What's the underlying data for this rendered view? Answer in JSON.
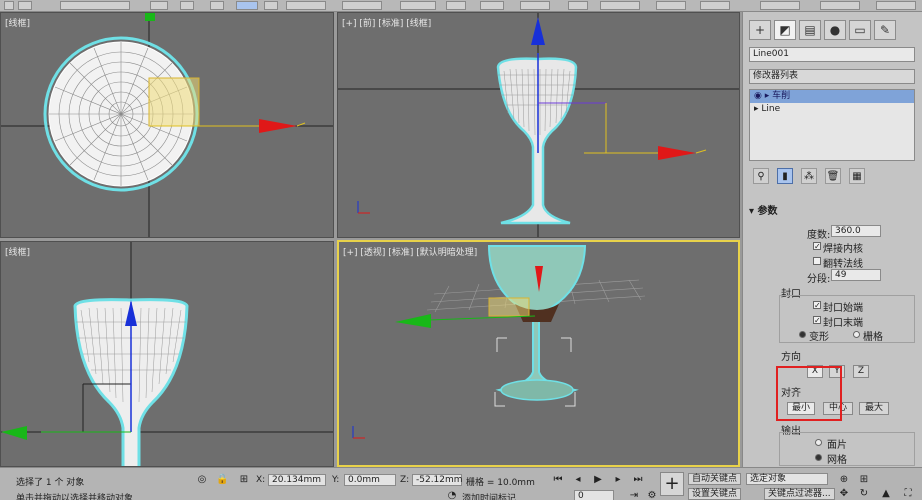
{
  "viewports": {
    "top_left": {
      "label": "[线框]"
    },
    "top_right": {
      "label": "[+] [前] [标准] [线框]"
    },
    "bottom_left": {
      "label": "[线框]"
    },
    "bottom_right": {
      "label": "[+] [透视] [标准] [默认明暗处理]"
    }
  },
  "panel": {
    "object_name": "Line001",
    "modifier_list": "修改器列表",
    "stack": [
      {
        "label": "车削",
        "selected": true
      },
      {
        "label": "Line",
        "selected": false
      }
    ],
    "params_title": "参数",
    "degrees_label": "度数:",
    "degrees_value": "360.0",
    "weld_core": "焊接内核",
    "flip_normals": "翻转法线",
    "segments_label": "分段:",
    "segments_value": "49",
    "capping_title": "封口",
    "cap_start": "封口始端",
    "cap_end": "封口末端",
    "morph": "变形",
    "grid": "栅格",
    "direction_title": "方向",
    "dir_x": "X",
    "dir_y": "Y",
    "dir_z": "Z",
    "align_title": "对齐",
    "align_min": "最小",
    "align_center": "中心",
    "align_max": "最大",
    "output_title": "输出",
    "out_patch": "面片",
    "out_mesh": "网格"
  },
  "status": {
    "selection": "选择了 1 个 对象",
    "hint": "单击并拖动以选择并移动对象",
    "x_label": "X:",
    "x_value": "20.134mm",
    "y_label": "Y:",
    "y_value": "0.0mm",
    "z_label": "Z:",
    "z_value": "-52.12mm",
    "grid_label": "栅格 = 10.0mm",
    "add_time_tag": "添加时间标记",
    "auto_key": "自动关键点",
    "selected_obj": "选定对象",
    "set_key": "设置关键点",
    "key_filters": "关键点过滤器...",
    "frame": "0"
  },
  "colors": {
    "viewport_bg": "#6e6e6e",
    "active_border": "#e8d24a",
    "wire": "#ffffff",
    "selection_cyan": "#6fe0e6",
    "axis_red": "#e01818",
    "axis_green": "#18b818",
    "axis_blue": "#1830d8",
    "highlight_red": "#e02020"
  }
}
